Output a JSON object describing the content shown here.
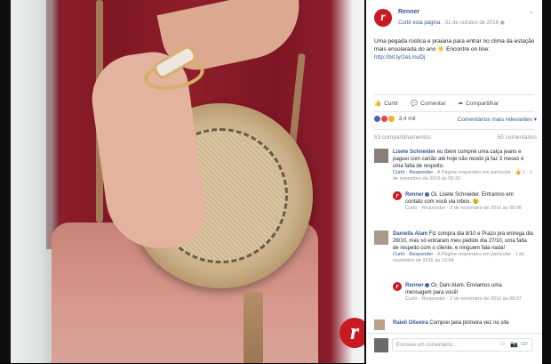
{
  "post": {
    "page_name": "Renner",
    "follow_label": "Curtir esta página",
    "separator": " · ",
    "date": "31 de outubro de 2016",
    "chevron": "⌄",
    "text": "Uma pegada rústica e praiana para entrar no clima da estação mais ensolarada do ano ☀️ Encontre on line: ",
    "link": "http://bit.ly/2eLmuDj",
    "logo_letter": "r"
  },
  "actions": {
    "like": "Curtir",
    "comment": "Comentar",
    "share": "Compartilhar"
  },
  "reactions": {
    "count": "3,4 mil",
    "relevant_label": "Comentários mais relevantes",
    "colors": [
      "#4267b2",
      "#f33e58",
      "#f7b125"
    ]
  },
  "counts": {
    "shares": "53 compartilhamentos",
    "comments": "50 comentários"
  },
  "comments": [
    {
      "name": "Lisete Schneider",
      "text": " eu tbém comprei uma calça jeans e paguei com cartão até hoje não recebi já faz 3 meses é uma falta de respeito.",
      "actions_like": "Curtir",
      "actions_reply": "Responder",
      "actions_rest": " · A Página respondeu em particular · 👍 1 · 1 de novembro de 2016 às 09:32",
      "reply": {
        "name": "Renner",
        "text": " Oi, Lisete Schneider. Entramos em contato com você via inbox. 😉",
        "actions": "Curtir · Responder · 2 de novembro de 2016 às 08:06"
      }
    },
    {
      "name": "Daniella Alam",
      "text": " Fiz compra dia 8/10 e Prazo pra entrega dia 28/10, mas só entraram meu pedido dia 27/10, uma falta de respeito com o cliente, e ninguem fala nada!",
      "actions_like": "Curtir",
      "actions_reply": "Responder",
      "actions_rest": " · A Página respondeu em particular · 1 de novembro de 2016 às 13:04",
      "reply": {
        "name": "Renner",
        "text": " Oi, Dani Alam. Enviamos uma mensagem para você!",
        "actions": "Curtir · Responder · 2 de novembro de 2016 às 08:07"
      }
    },
    {
      "name": "Raieli Oliveira",
      "text": " Comprei pela primeira vez no site"
    }
  ],
  "composer": {
    "placeholder": "Escreva um comentário...",
    "icons": [
      "☺",
      "📷",
      "GIF"
    ]
  }
}
